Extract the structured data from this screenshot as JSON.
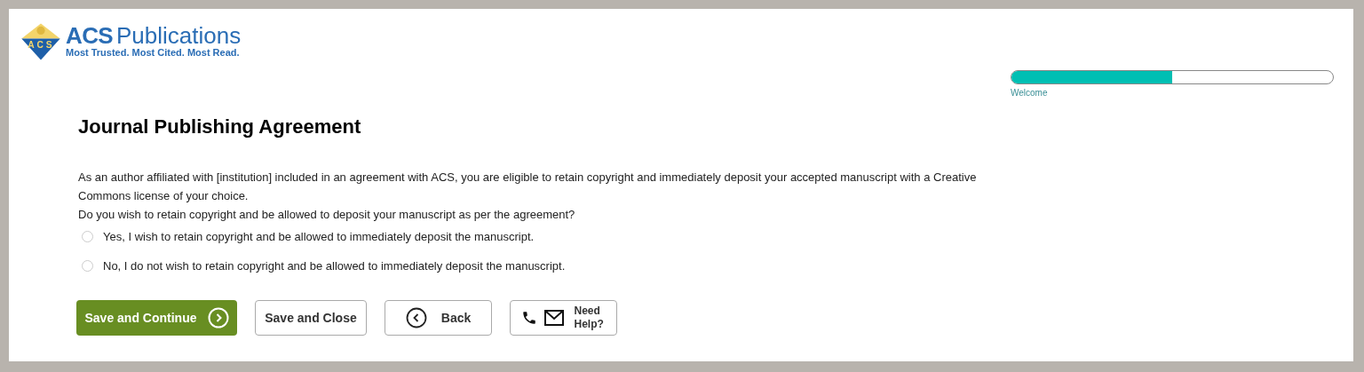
{
  "logo": {
    "emblem_letters": [
      "A",
      "C",
      "S"
    ],
    "name_bold": "ACS",
    "name": "Publications",
    "tagline": "Most Trusted. Most Cited. Most Read."
  },
  "progress": {
    "level": 0.5,
    "label": "Welcome"
  },
  "title": "Journal Publishing Agreement",
  "paragraphs": [
    "As an author affiliated with [institution] included in an agreement with ACS, you are eligible to retain copyright and immediately deposit your accepted manuscript with a Creative Commons license of your choice.",
    "Do you wish to retain copyright and be allowed to deposit your manuscript as per the agreement?"
  ],
  "options": [
    {
      "label": "Yes, I wish to retain copyright and be allowed to immediately deposit the manuscript.",
      "selected": false
    },
    {
      "label": "No, I do not wish to retain copyright and be allowed to immediately deposit the manuscript.",
      "selected": false
    }
  ],
  "buttons": [
    {
      "kind": "primary",
      "label": "Save and Continue"
    },
    {
      "kind": "plain",
      "label": "Save and Close"
    },
    {
      "kind": "back",
      "label": "Back"
    },
    {
      "kind": "help",
      "label": "Need Help?"
    }
  ]
}
